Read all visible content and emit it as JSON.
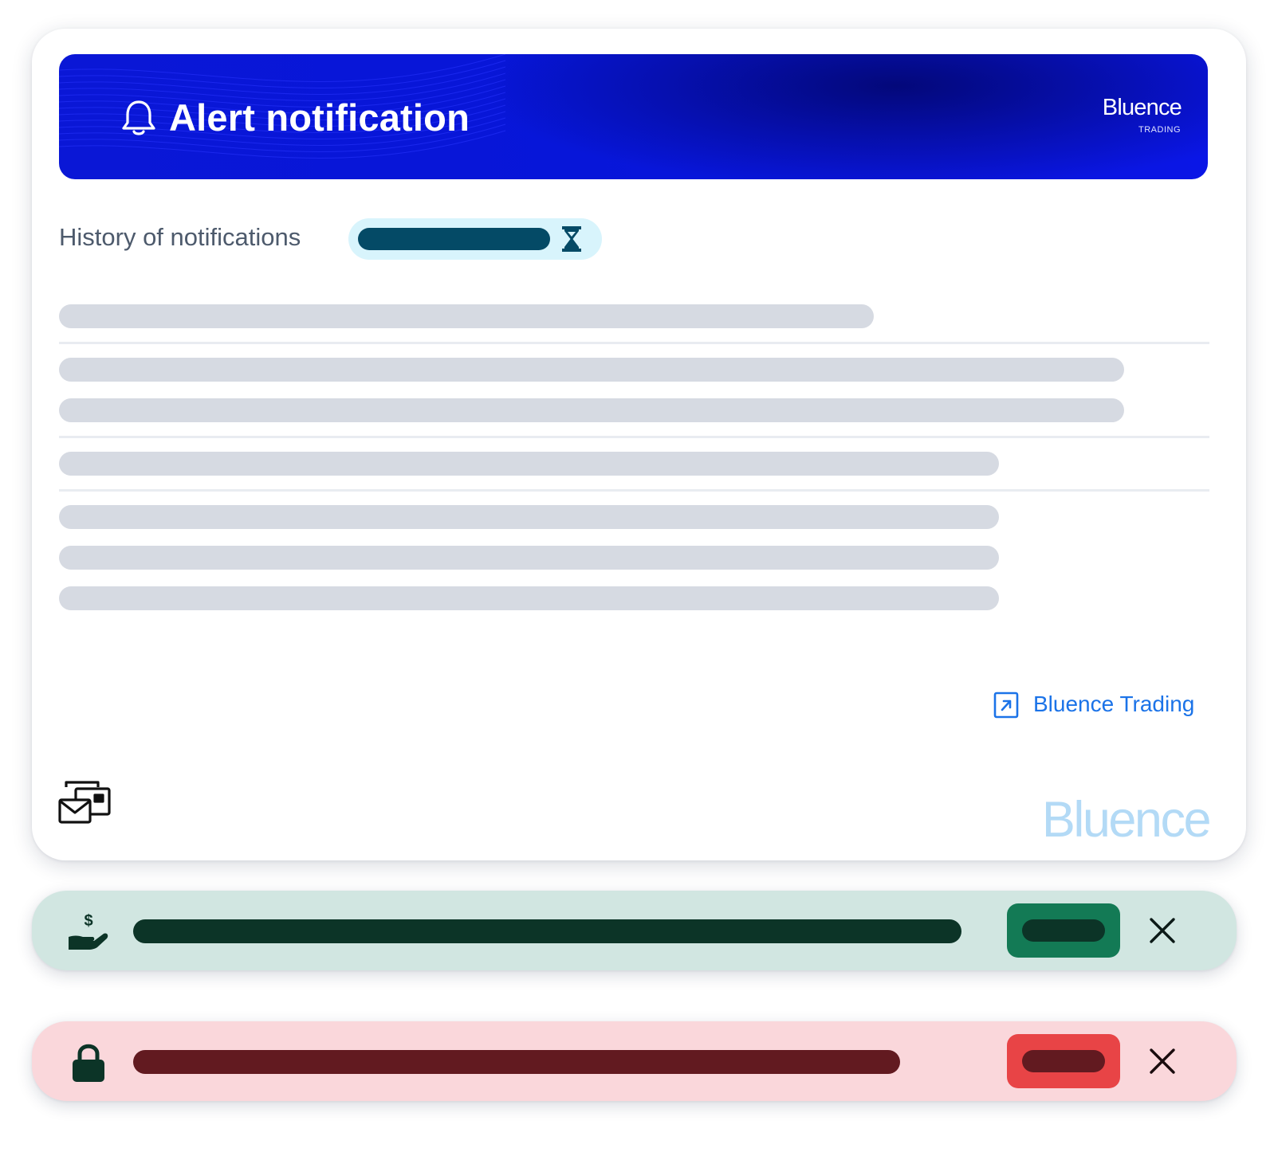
{
  "alert_card": {
    "title": "Alert notification",
    "brand": {
      "name": "Bluence",
      "subtitle": "TRADING"
    },
    "history_label": "History of notifications",
    "link_label": "Bluence Trading",
    "footer_logo": "Bluence"
  },
  "icons": {
    "banner": "bell-icon",
    "pending": "hourglass-icon",
    "link": "external-link-icon",
    "footer": "mail-card-icon",
    "success_toast": "hand-dollar-icon",
    "error_toast": "lock-icon",
    "dismiss": "close-icon"
  },
  "colors": {
    "banner_blue": "#0a16dc",
    "link_blue": "#1b73e8",
    "pending_pill_bg": "#d8f4fc",
    "pending_bar": "#044a66",
    "skeleton": "#d6dae2",
    "success_bg": "#d1e6e1",
    "success_button": "#137a55",
    "success_text": "#0c3427",
    "error_bg": "#fad7db",
    "error_button": "#e84446",
    "error_text": "#621a20"
  }
}
